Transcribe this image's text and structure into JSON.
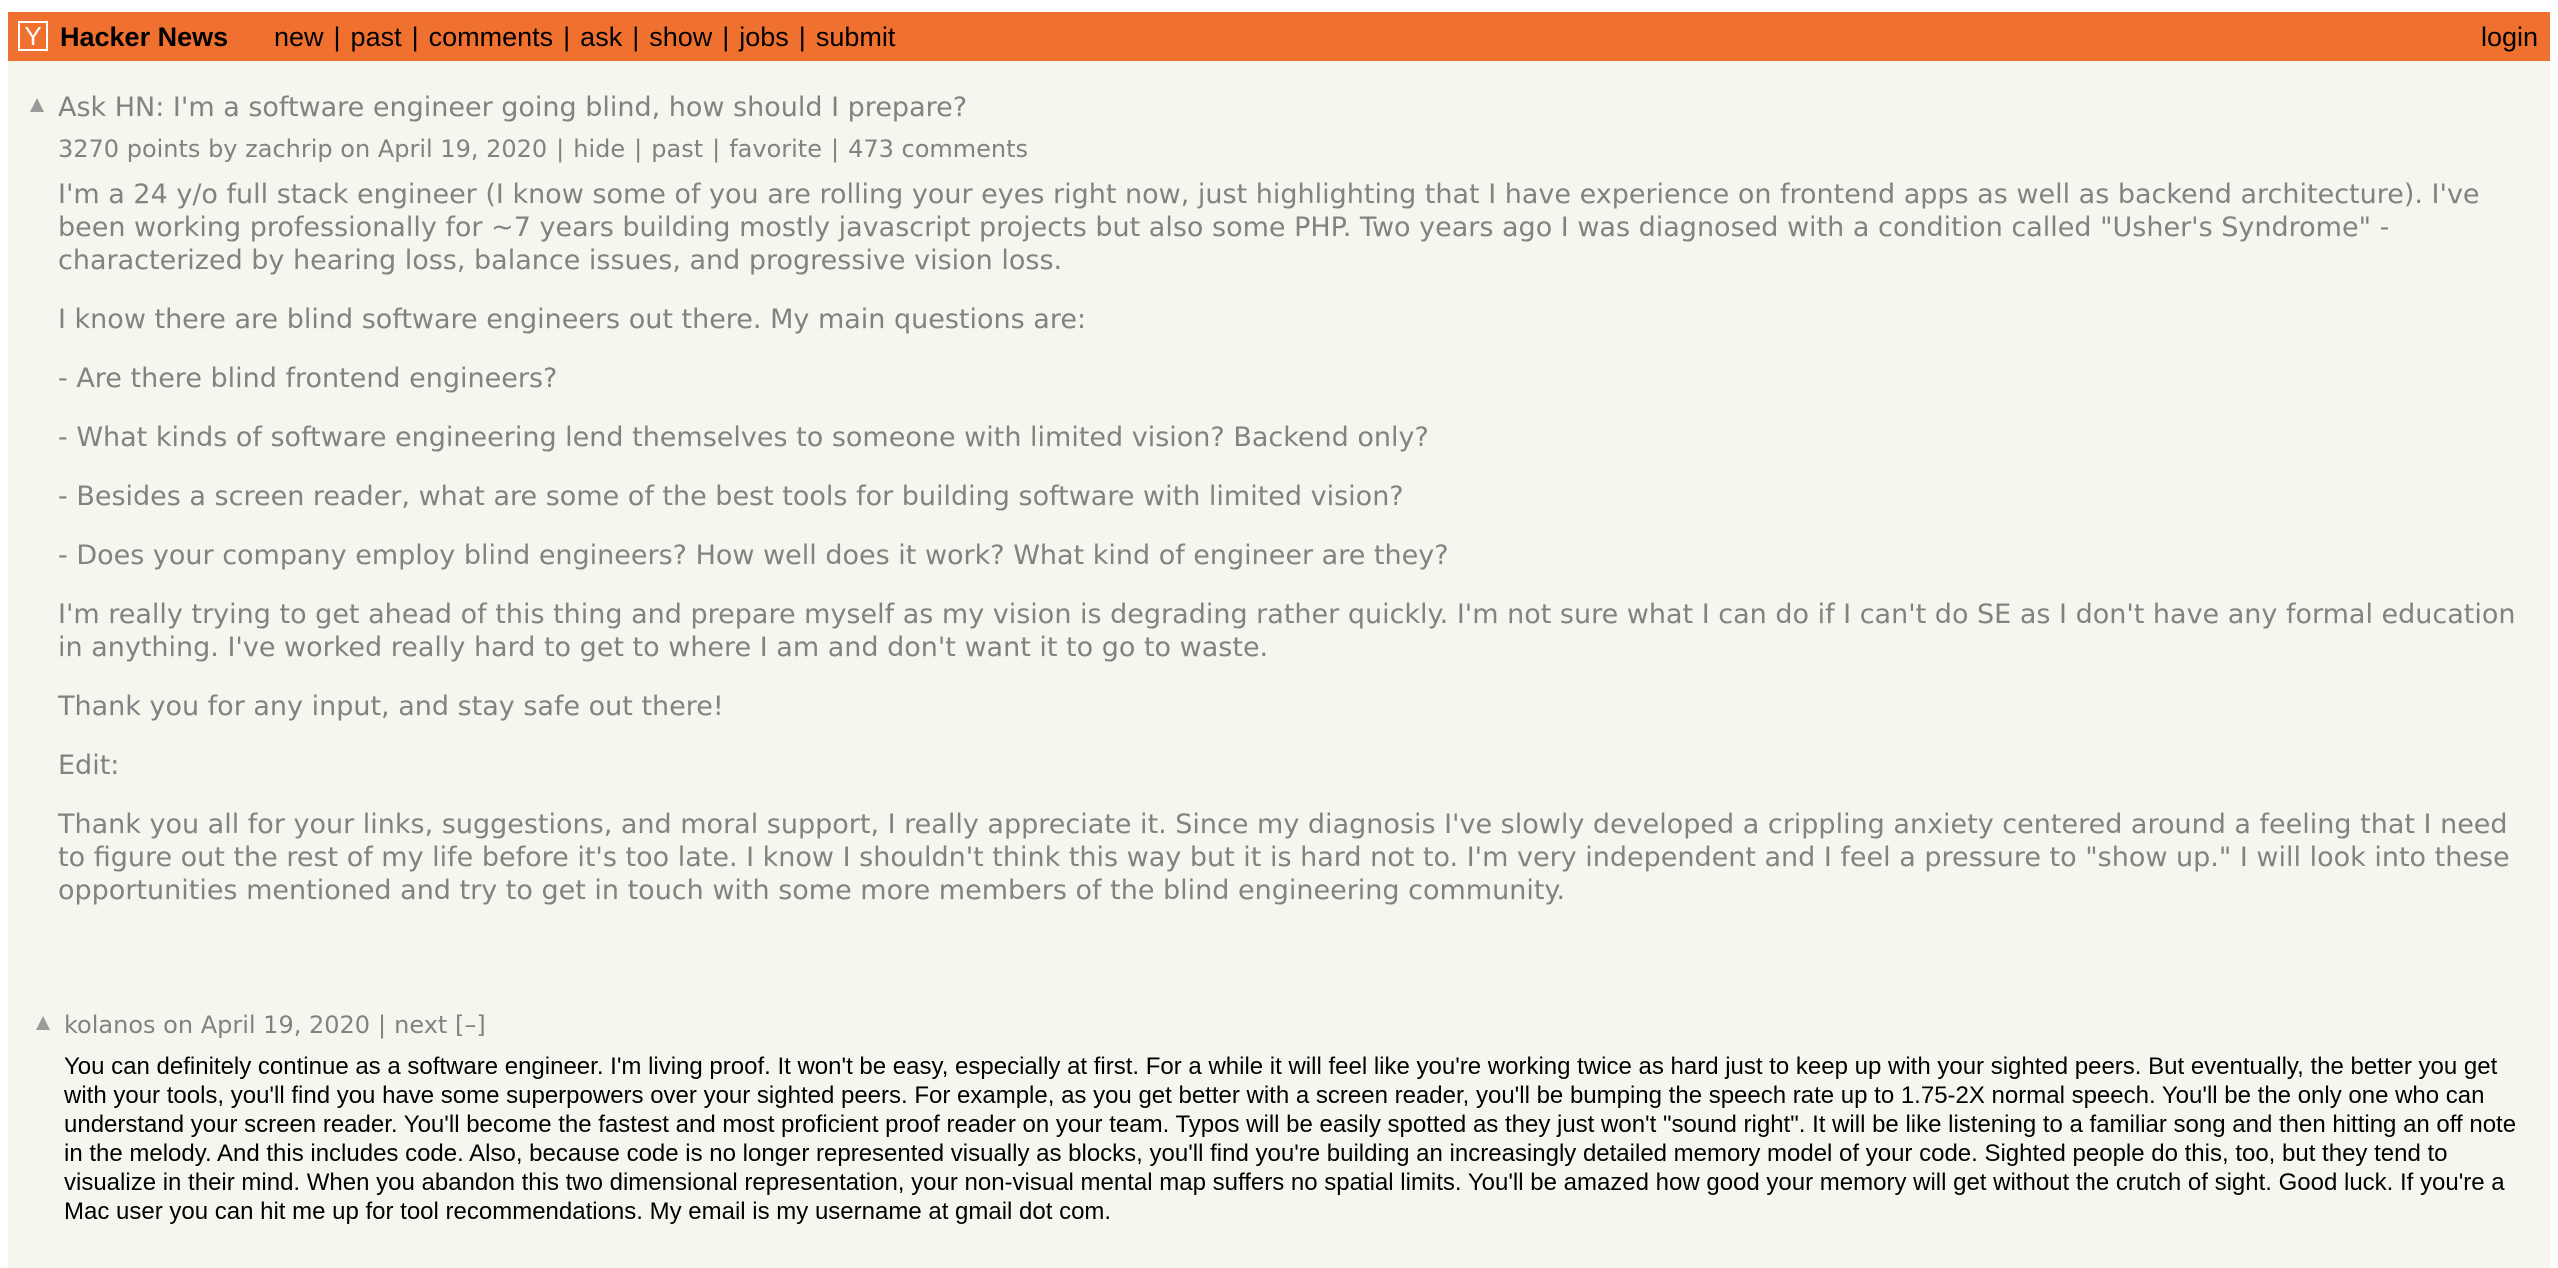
{
  "header": {
    "logo_letter": "Y",
    "site_title": "Hacker News",
    "nav": [
      "new",
      "past",
      "comments",
      "ask",
      "show",
      "jobs",
      "submit"
    ],
    "login": "login",
    "color": "#f07030"
  },
  "story": {
    "title": "Ask HN: I'm a software engineer going blind, how should I prepare?",
    "points": "3270 points",
    "by_label": "by",
    "user": "zachrip",
    "on_label": "on",
    "date": "April 19, 2020",
    "links": [
      "hide",
      "past",
      "favorite",
      "473 comments"
    ],
    "paragraphs": [
      "I'm a 24 y/o full stack engineer (I know some of you are rolling your eyes right now, just highlighting that I have experience on frontend apps as well as backend architecture). I've been working professionally for ~7 years building mostly javascript projects but also some PHP. Two years ago I was diagnosed with a condition called \"Usher's Syndrome\" - characterized by hearing loss, balance issues, and progressive vision loss.",
      "I know there are blind software engineers out there. My main questions are:",
      "- Are there blind frontend engineers?",
      "- What kinds of software engineering lend themselves to someone with limited vision? Backend only?",
      "- Besides a screen reader, what are some of the best tools for building software with limited vision?",
      "- Does your company employ blind engineers? How well does it work? What kind of engineer are they?",
      "I'm really trying to get ahead of this thing and prepare myself as my vision is degrading rather quickly. I'm not sure what I can do if I can't do SE as I don't have any formal education in anything. I've worked really hard to get to where I am and don't want it to go to waste.",
      "Thank you for any input, and stay safe out there!",
      "Edit:",
      "Thank you all for your links, suggestions, and moral support, I really appreciate it. Since my diagnosis I've slowly developed a crippling anxiety centered around a feeling that I need to figure out the rest of my life before it's too late. I know I shouldn't think this way but it is hard not to. I'm very independent and I feel a pressure to \"show up.\" I will look into these opportunities mentioned and try to get in touch with some more members of the blind engineering community."
    ]
  },
  "comment": {
    "user": "kolanos",
    "on_label": "on",
    "date": "April 19, 2020",
    "next": "next",
    "toggle": "[–]",
    "text": "You can definitely continue as a software engineer. I'm living proof. It won't be easy, especially at first. For a while it will feel like you're working twice as hard just to keep up with your sighted peers. But eventually, the better you get with your tools, you'll find you have some superpowers over your sighted peers. For example, as you get better with a screen reader, you'll be bumping the speech rate up to 1.75-2X normal speech. You'll be the only one who can understand your screen reader. You'll become the fastest and most proficient proof reader on your team. Typos will be easily spotted as they just won't \"sound right\". It will be like listening to a familiar song and then hitting an off note in the melody. And this includes code. Also, because code is no longer represented visually as blocks, you'll find you're building an increasingly detailed memory model of your code. Sighted people do this, too, but they tend to visualize in their mind. When you abandon this two dimensional representation, your non-visual mental map suffers no spatial limits. You'll be amazed how good your memory will get without the crutch of sight. Good luck. If you're a Mac user you can hit me up for tool recommendations. My email is my username at gmail dot com."
  }
}
